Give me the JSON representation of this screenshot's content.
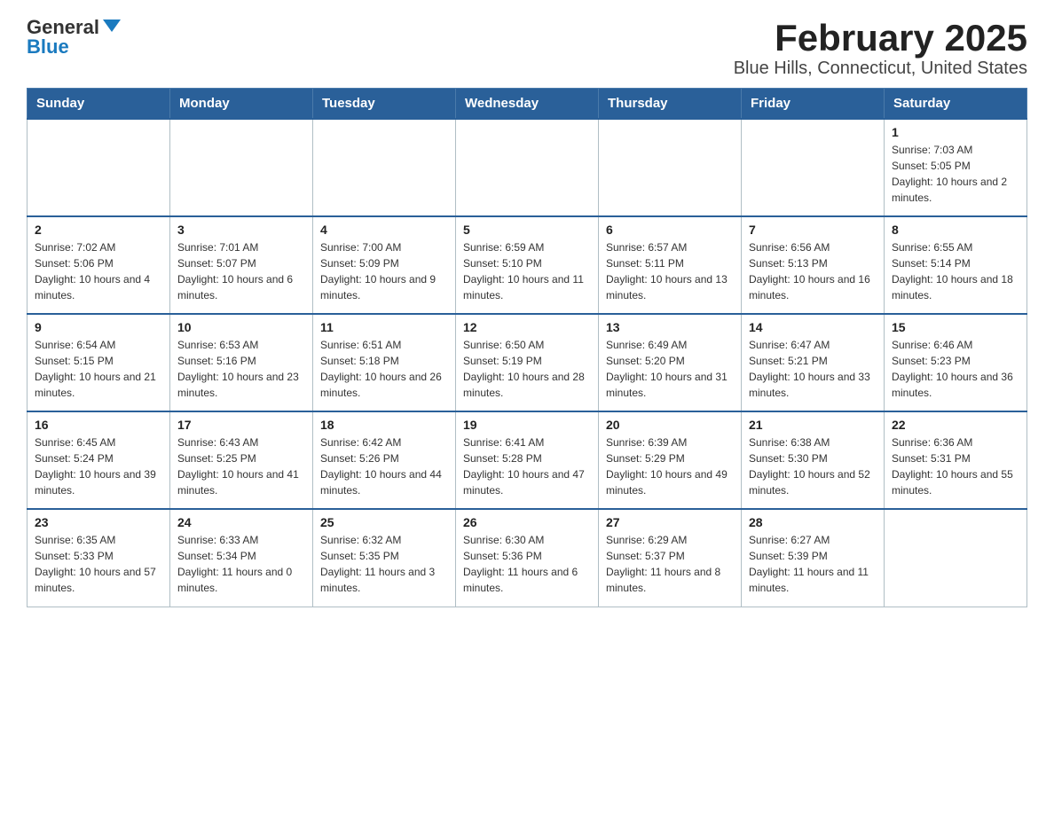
{
  "logo": {
    "general": "General",
    "blue": "Blue"
  },
  "title": "February 2025",
  "subtitle": "Blue Hills, Connecticut, United States",
  "days_of_week": [
    "Sunday",
    "Monday",
    "Tuesday",
    "Wednesday",
    "Thursday",
    "Friday",
    "Saturday"
  ],
  "weeks": [
    [
      {
        "day": "",
        "info": ""
      },
      {
        "day": "",
        "info": ""
      },
      {
        "day": "",
        "info": ""
      },
      {
        "day": "",
        "info": ""
      },
      {
        "day": "",
        "info": ""
      },
      {
        "day": "",
        "info": ""
      },
      {
        "day": "1",
        "info": "Sunrise: 7:03 AM\nSunset: 5:05 PM\nDaylight: 10 hours and 2 minutes."
      }
    ],
    [
      {
        "day": "2",
        "info": "Sunrise: 7:02 AM\nSunset: 5:06 PM\nDaylight: 10 hours and 4 minutes."
      },
      {
        "day": "3",
        "info": "Sunrise: 7:01 AM\nSunset: 5:07 PM\nDaylight: 10 hours and 6 minutes."
      },
      {
        "day": "4",
        "info": "Sunrise: 7:00 AM\nSunset: 5:09 PM\nDaylight: 10 hours and 9 minutes."
      },
      {
        "day": "5",
        "info": "Sunrise: 6:59 AM\nSunset: 5:10 PM\nDaylight: 10 hours and 11 minutes."
      },
      {
        "day": "6",
        "info": "Sunrise: 6:57 AM\nSunset: 5:11 PM\nDaylight: 10 hours and 13 minutes."
      },
      {
        "day": "7",
        "info": "Sunrise: 6:56 AM\nSunset: 5:13 PM\nDaylight: 10 hours and 16 minutes."
      },
      {
        "day": "8",
        "info": "Sunrise: 6:55 AM\nSunset: 5:14 PM\nDaylight: 10 hours and 18 minutes."
      }
    ],
    [
      {
        "day": "9",
        "info": "Sunrise: 6:54 AM\nSunset: 5:15 PM\nDaylight: 10 hours and 21 minutes."
      },
      {
        "day": "10",
        "info": "Sunrise: 6:53 AM\nSunset: 5:16 PM\nDaylight: 10 hours and 23 minutes."
      },
      {
        "day": "11",
        "info": "Sunrise: 6:51 AM\nSunset: 5:18 PM\nDaylight: 10 hours and 26 minutes."
      },
      {
        "day": "12",
        "info": "Sunrise: 6:50 AM\nSunset: 5:19 PM\nDaylight: 10 hours and 28 minutes."
      },
      {
        "day": "13",
        "info": "Sunrise: 6:49 AM\nSunset: 5:20 PM\nDaylight: 10 hours and 31 minutes."
      },
      {
        "day": "14",
        "info": "Sunrise: 6:47 AM\nSunset: 5:21 PM\nDaylight: 10 hours and 33 minutes."
      },
      {
        "day": "15",
        "info": "Sunrise: 6:46 AM\nSunset: 5:23 PM\nDaylight: 10 hours and 36 minutes."
      }
    ],
    [
      {
        "day": "16",
        "info": "Sunrise: 6:45 AM\nSunset: 5:24 PM\nDaylight: 10 hours and 39 minutes."
      },
      {
        "day": "17",
        "info": "Sunrise: 6:43 AM\nSunset: 5:25 PM\nDaylight: 10 hours and 41 minutes."
      },
      {
        "day": "18",
        "info": "Sunrise: 6:42 AM\nSunset: 5:26 PM\nDaylight: 10 hours and 44 minutes."
      },
      {
        "day": "19",
        "info": "Sunrise: 6:41 AM\nSunset: 5:28 PM\nDaylight: 10 hours and 47 minutes."
      },
      {
        "day": "20",
        "info": "Sunrise: 6:39 AM\nSunset: 5:29 PM\nDaylight: 10 hours and 49 minutes."
      },
      {
        "day": "21",
        "info": "Sunrise: 6:38 AM\nSunset: 5:30 PM\nDaylight: 10 hours and 52 minutes."
      },
      {
        "day": "22",
        "info": "Sunrise: 6:36 AM\nSunset: 5:31 PM\nDaylight: 10 hours and 55 minutes."
      }
    ],
    [
      {
        "day": "23",
        "info": "Sunrise: 6:35 AM\nSunset: 5:33 PM\nDaylight: 10 hours and 57 minutes."
      },
      {
        "day": "24",
        "info": "Sunrise: 6:33 AM\nSunset: 5:34 PM\nDaylight: 11 hours and 0 minutes."
      },
      {
        "day": "25",
        "info": "Sunrise: 6:32 AM\nSunset: 5:35 PM\nDaylight: 11 hours and 3 minutes."
      },
      {
        "day": "26",
        "info": "Sunrise: 6:30 AM\nSunset: 5:36 PM\nDaylight: 11 hours and 6 minutes."
      },
      {
        "day": "27",
        "info": "Sunrise: 6:29 AM\nSunset: 5:37 PM\nDaylight: 11 hours and 8 minutes."
      },
      {
        "day": "28",
        "info": "Sunrise: 6:27 AM\nSunset: 5:39 PM\nDaylight: 11 hours and 11 minutes."
      },
      {
        "day": "",
        "info": ""
      }
    ]
  ]
}
